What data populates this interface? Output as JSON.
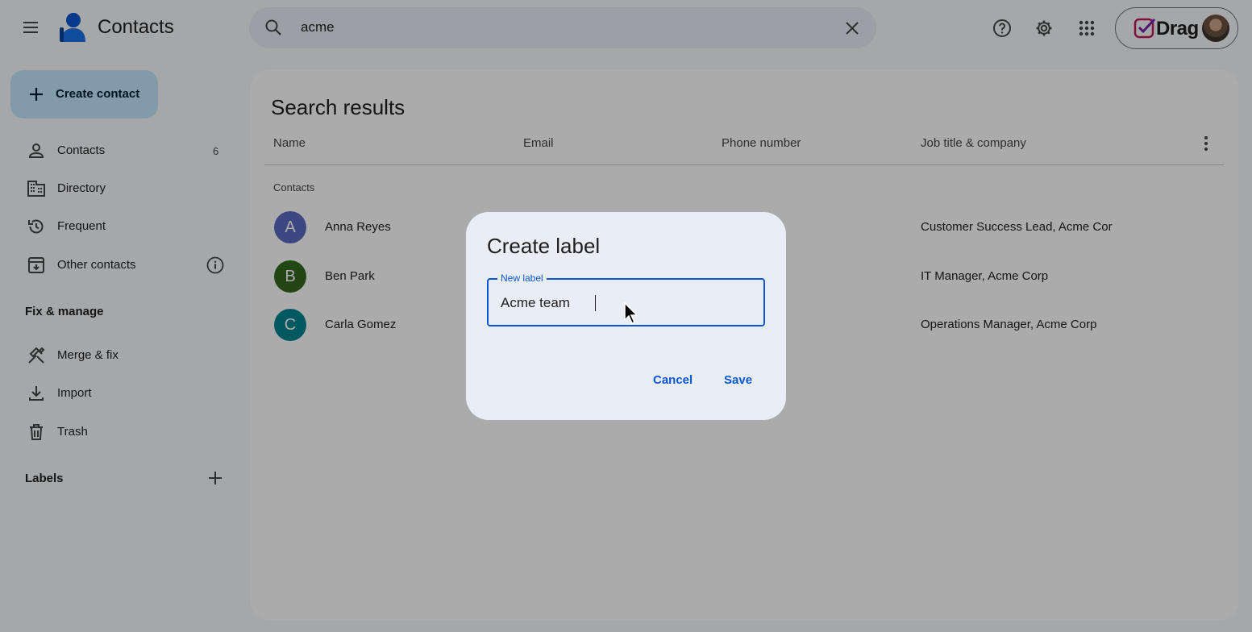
{
  "header": {
    "app_title": "Contacts",
    "search_value": "acme",
    "account_chip_text": "Drag",
    "icons": [
      "menu-icon",
      "search-icon",
      "close-icon",
      "help-icon",
      "gear-icon",
      "apps-grid-icon"
    ]
  },
  "sidebar": {
    "create_label": "Create contact",
    "items": [
      {
        "label": "Contacts",
        "count": "6",
        "icon": "person-icon"
      },
      {
        "label": "Directory",
        "icon": "building-icon"
      },
      {
        "label": "Frequent",
        "icon": "history-icon"
      },
      {
        "label": "Other contacts",
        "icon": "archive-icon"
      }
    ],
    "fix_manage_title": "Fix & manage",
    "fix_items": [
      {
        "label": "Merge & fix",
        "icon": "tools-icon"
      },
      {
        "label": "Import",
        "icon": "download-icon"
      },
      {
        "label": "Trash",
        "icon": "trash-icon"
      }
    ],
    "labels_title": "Labels"
  },
  "main": {
    "title": "Search results",
    "columns": [
      "Name",
      "Email",
      "Phone number",
      "Job title & company"
    ],
    "group_label": "Contacts",
    "rows": [
      {
        "initial": "A",
        "name": "Anna Reyes",
        "job": "Customer Success Lead, Acme Corp",
        "color": "#5c6bc0"
      },
      {
        "initial": "B",
        "name": "Ben Park",
        "job": "IT Manager, Acme Corp",
        "color": "#33691e"
      },
      {
        "initial": "C",
        "name": "Carla Gomez",
        "job": "Operations Manager, Acme Corp",
        "color": "#00838f"
      }
    ]
  },
  "dialog": {
    "title": "Create label",
    "field_label": "New label",
    "field_value": "Acme team",
    "cancel_label": "Cancel",
    "save_label": "Save"
  },
  "colors": {
    "accent": "#0b57d0",
    "create_button_bg": "#c2e7ff",
    "dialog_bg": "#e9eef6"
  }
}
